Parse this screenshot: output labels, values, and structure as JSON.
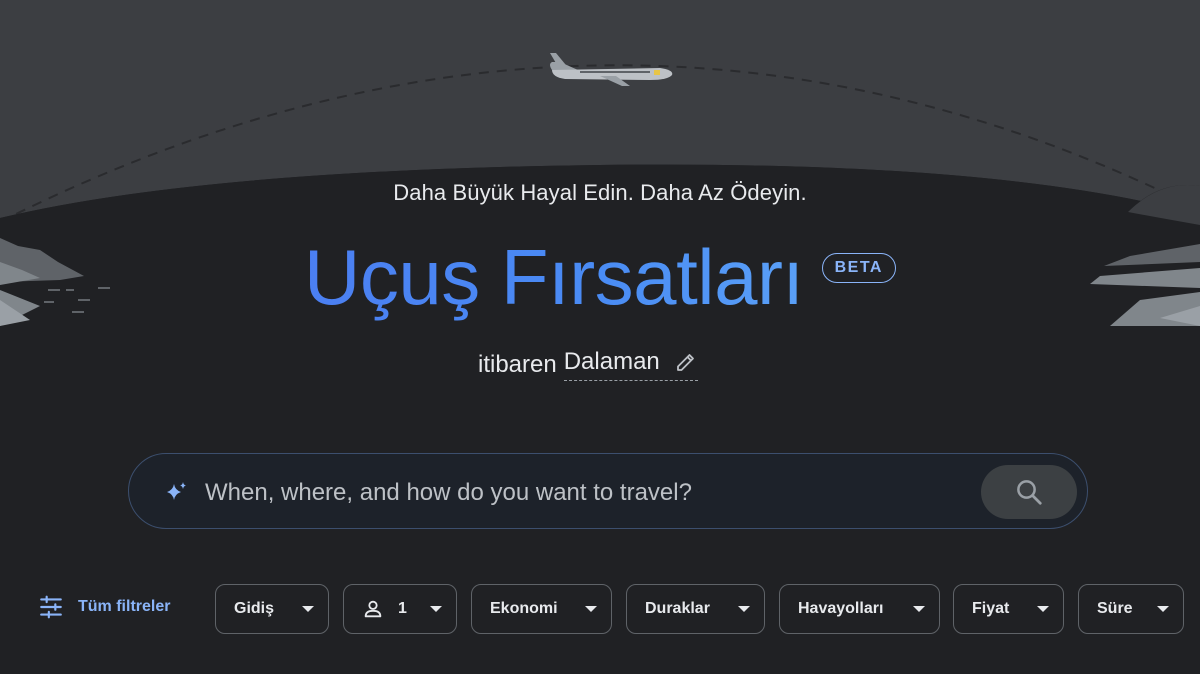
{
  "hero": {
    "tagline": "Daha Büyük Hayal Edin. Daha Az Ödeyin.",
    "title": "Uçuş Fırsatları",
    "badge": "BETA",
    "origin_prefix": "itibaren",
    "origin_city": "Dalaman"
  },
  "search": {
    "placeholder": "When, where, and how do you want to travel?"
  },
  "filters": {
    "all_filters_label": "Tüm filtreler",
    "chips": [
      {
        "label": "Gidiş"
      },
      {
        "label": "1"
      },
      {
        "label": "Ekonomi"
      },
      {
        "label": "Duraklar"
      },
      {
        "label": "Havayolları"
      },
      {
        "label": "Fiyat"
      },
      {
        "label": "Süre"
      }
    ]
  },
  "colors": {
    "background": "#202124",
    "accent": "#8ab4f8",
    "title_blue": "#4a8af4"
  },
  "icons": [
    "sparkle-icon",
    "search-icon",
    "edit-pencil-icon",
    "tune-icon",
    "person-icon",
    "caret-down-icon",
    "airplane-icon"
  ]
}
